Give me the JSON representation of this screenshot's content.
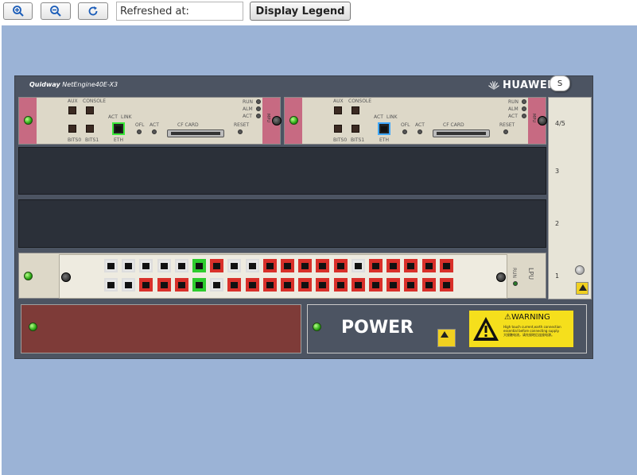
{
  "toolbar": {
    "zoom_in_icon": "zoom-in-icon",
    "zoom_out_icon": "zoom-out-icon",
    "reset_icon": "refresh-icon",
    "refresh_value": "Refreshed at:",
    "legend_label": "Display Legend"
  },
  "device": {
    "series": "Quidway",
    "model": "NetEngine40E-X3",
    "brand": "HUAWEI",
    "tooltip": "S"
  },
  "mpu": {
    "aux": "AUX",
    "console": "CONSOLE",
    "bits0": "BITS0",
    "bits1": "BITS1",
    "act": "ACT",
    "link": "LINK",
    "eth": "ETH",
    "ofl": "OFL",
    "act2": "ACT",
    "cf_card": "CF CARD",
    "reset": "RESET",
    "run": "RUN",
    "alm": "ALM",
    "act3": "ACT",
    "label": "MPU"
  },
  "lpu": {
    "run": "RUN",
    "label": "LPU",
    "port_colors": {
      "top": [
        "w",
        "w",
        "w",
        "w",
        "w",
        "g",
        "r",
        "w",
        "w",
        "r",
        "r",
        "r",
        "r",
        "r",
        "w",
        "r",
        "r",
        "r",
        "r",
        "r"
      ],
      "bottom": [
        "w",
        "w",
        "r",
        "r",
        "r",
        "g",
        "w",
        "r",
        "r",
        "r",
        "r",
        "r",
        "r",
        "r",
        "r",
        "r",
        "r",
        "r",
        "r",
        "r"
      ]
    }
  },
  "slots": {
    "s45": "4/5",
    "s3": "3",
    "s2": "2",
    "s1": "1"
  },
  "power": {
    "label": "POWER",
    "warning": "WARNING",
    "warning_text": "High touch current,earth connection essential before connecting supply.",
    "warning_text_cn": "大接触电流，请先接地后连接电源。",
    "esd": "ESD"
  },
  "colors": {
    "canvas": "#9bb3d6",
    "chassis": "#4c5462",
    "port_red": "#d8302a",
    "port_green": "#2ecc2e",
    "led_green": "#2ba814"
  }
}
